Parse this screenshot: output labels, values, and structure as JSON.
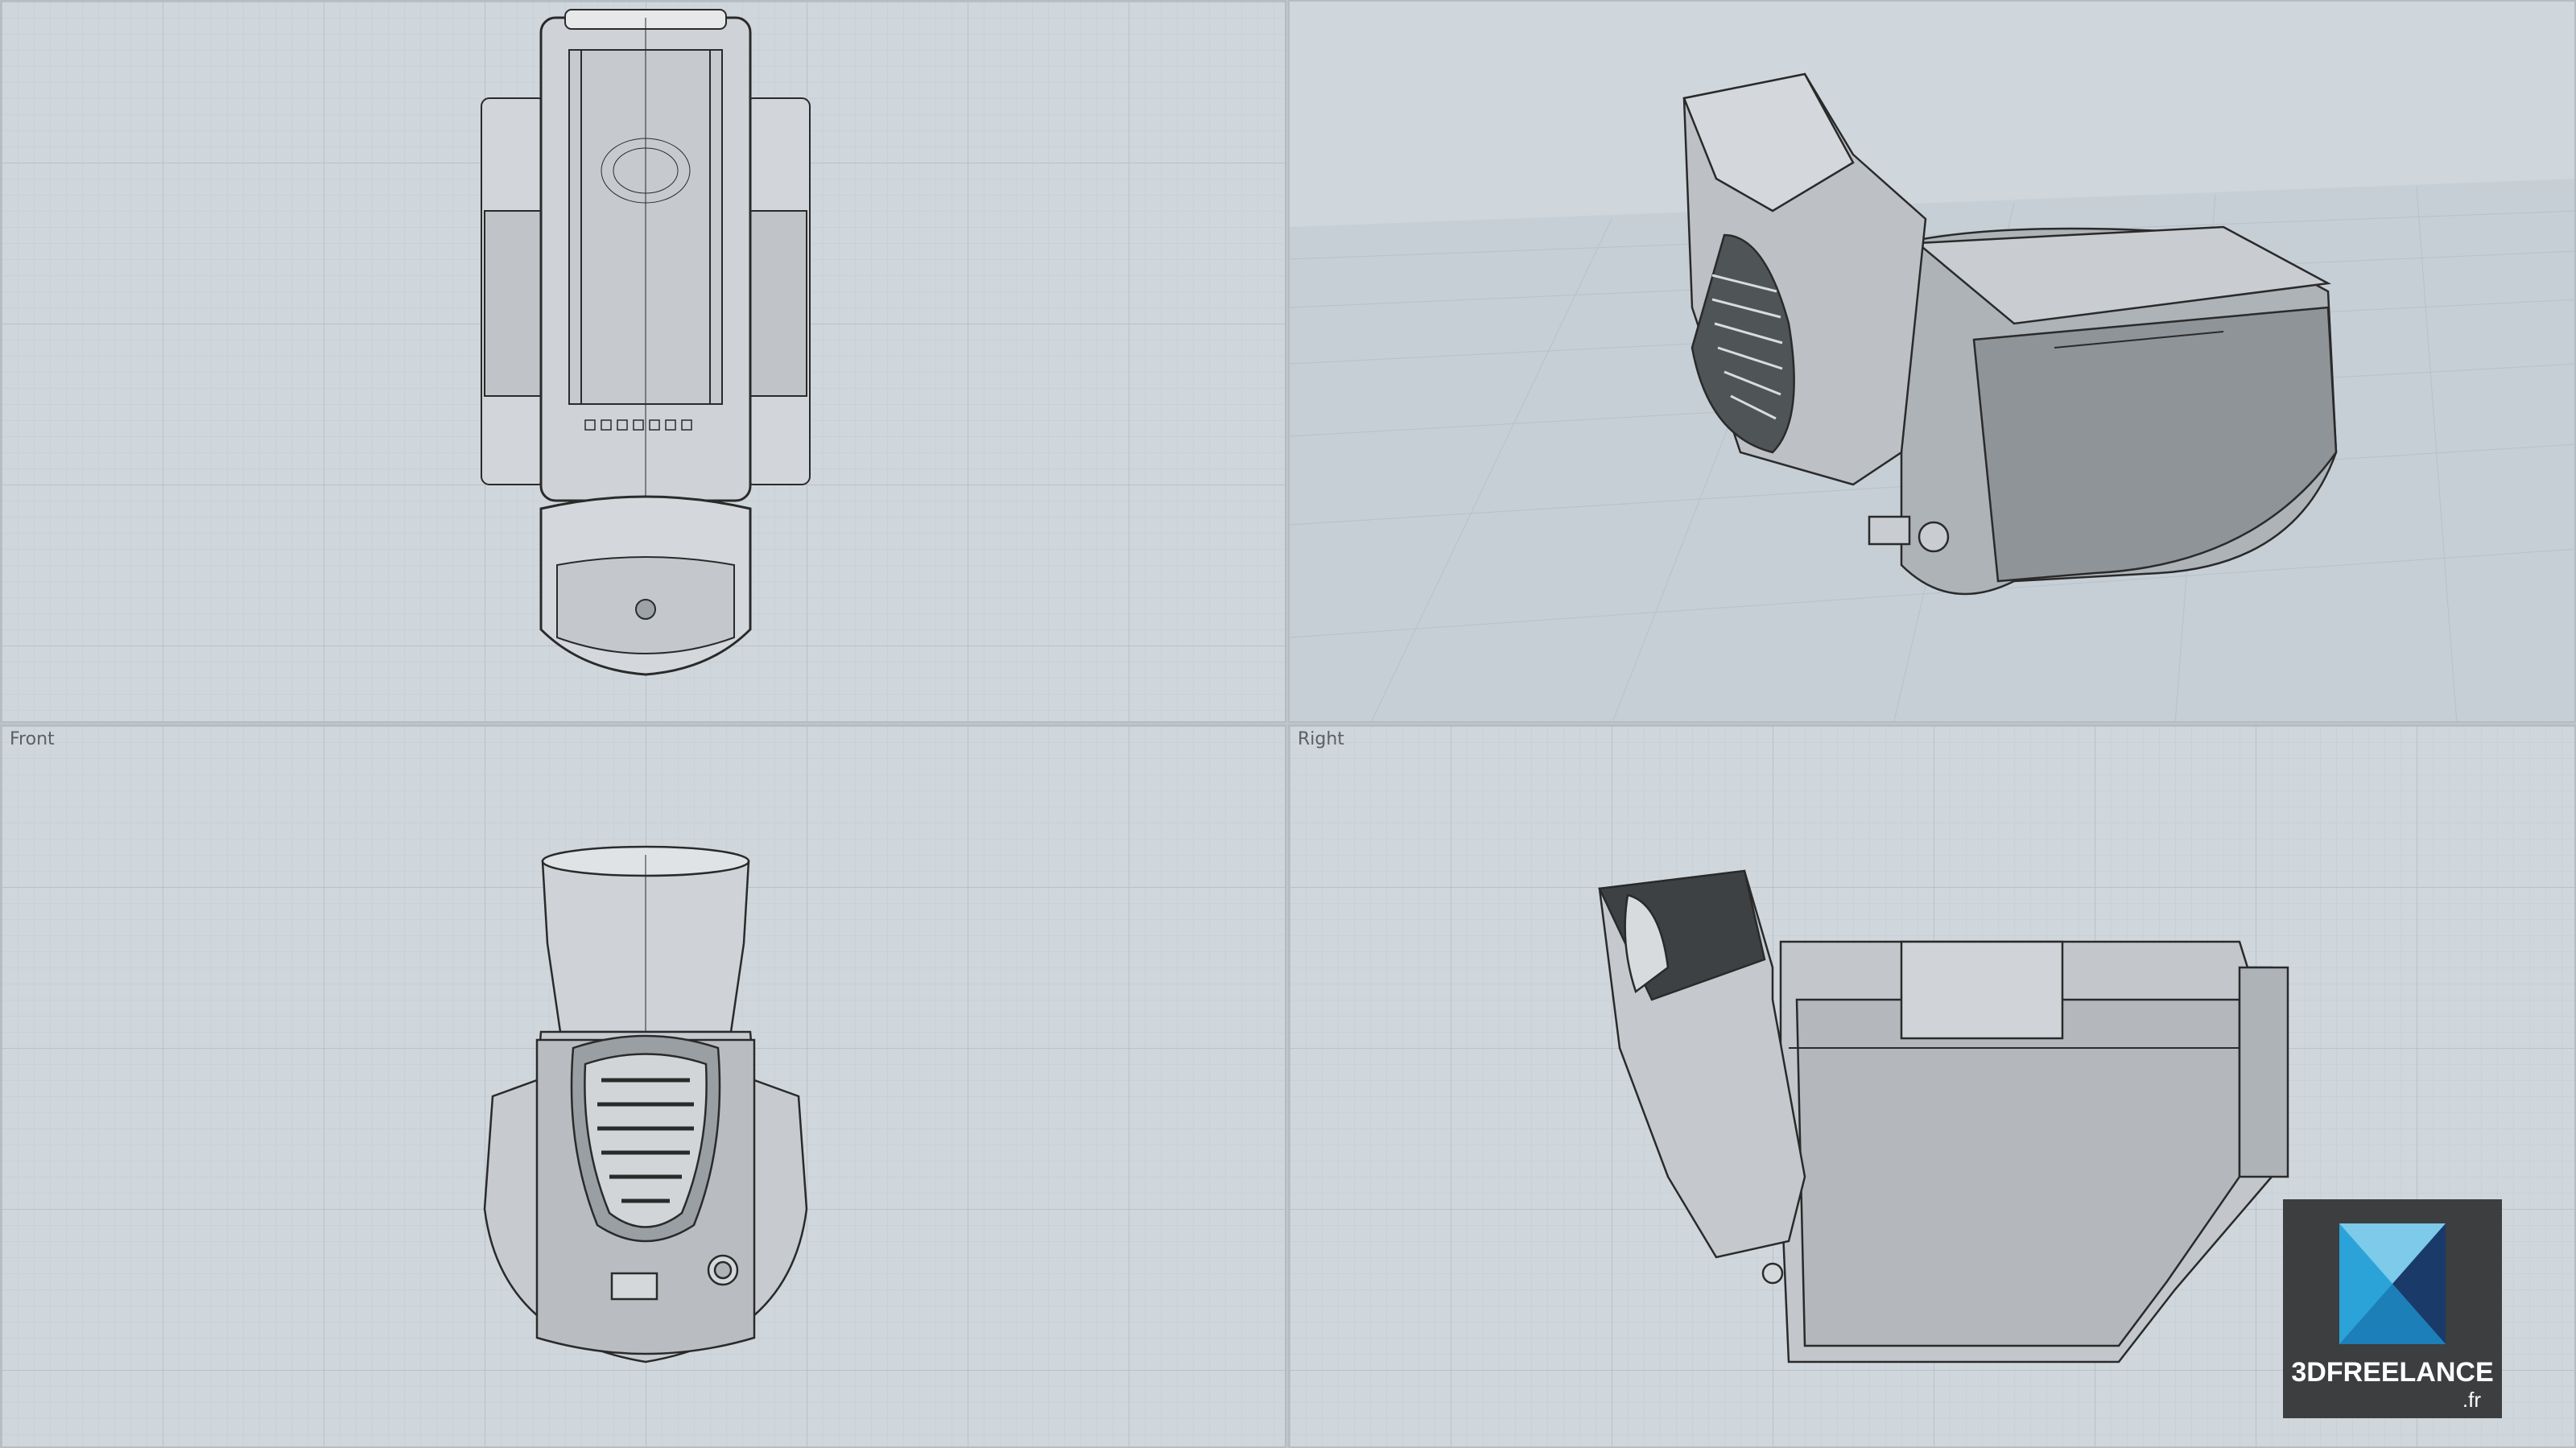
{
  "app": {
    "viewports": [
      {
        "id": "top",
        "label": ""
      },
      {
        "id": "perspective",
        "label": ""
      },
      {
        "id": "front",
        "label": "Front"
      },
      {
        "id": "right",
        "label": "Right"
      }
    ]
  },
  "logo": {
    "text": "3DFREELANCE",
    "suffix": ".fr",
    "colors": {
      "background": "#3d3e40",
      "primary": "#2ba3d8",
      "dark": "#1a3a6a"
    }
  },
  "colors": {
    "viewport_bg": "#cfd7dd",
    "grid_minor": "#c4ccd2",
    "grid_major": "#b4bcc3",
    "model_stroke": "#2a2a2a",
    "model_fill": "#c8ccd0"
  }
}
